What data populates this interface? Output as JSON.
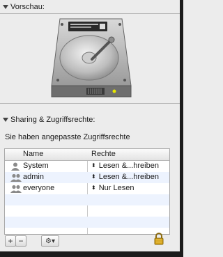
{
  "preview": {
    "title": "Vorschau:",
    "icon": "hard-drive-icon"
  },
  "sharing": {
    "title": "Sharing & Zugriffsrechte:",
    "custom_access_text": "Sie haben angepasste Zugriffsrechte",
    "columns": {
      "name": "Name",
      "privilege": "Rechte"
    },
    "rows": [
      {
        "name": "System",
        "privilege": "Lesen &...hreiben",
        "icon": "user-icon"
      },
      {
        "name": "admin",
        "privilege": "Lesen &...hreiben",
        "icon": "group-icon"
      },
      {
        "name": "everyone",
        "privilege": "Nur Lesen",
        "icon": "group-icon"
      }
    ]
  },
  "toolbar": {
    "add_label": "+",
    "remove_label": "−",
    "action_label": "⚙▾"
  },
  "lock": {
    "icon": "lock-icon",
    "color": "#d4a21a"
  }
}
